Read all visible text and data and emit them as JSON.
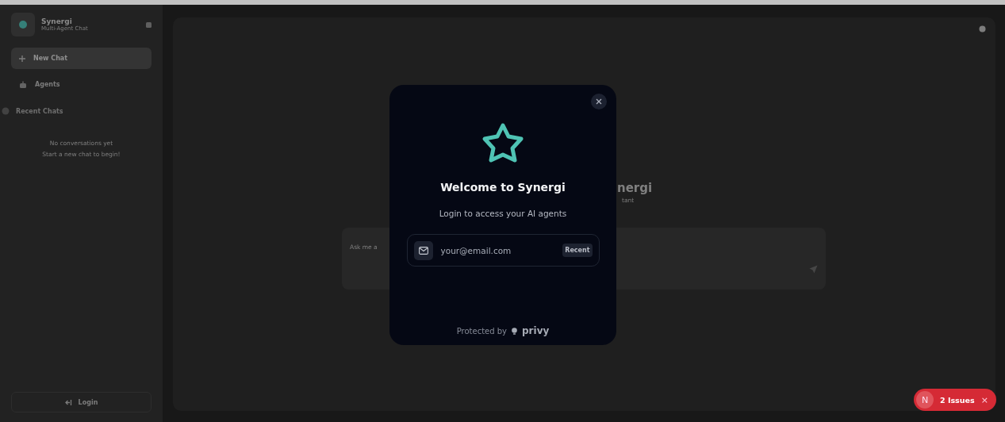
{
  "sidebar": {
    "brand": {
      "title": "Synergi",
      "subtitle": "Multi-Agent Chat"
    },
    "nav": [
      {
        "label": "New Chat",
        "kind": "new",
        "selected": true
      },
      {
        "label": "Agents",
        "kind": "agents",
        "selected": false
      }
    ],
    "recent": {
      "label": "Recent Chats",
      "empty_lines": [
        "No conversations yet",
        "Start a new chat to begin!"
      ]
    },
    "login": "Login"
  },
  "main": {
    "heading": "nergi",
    "subheading": "tant",
    "input": {
      "placeholder": "Ask me a"
    }
  },
  "modal": {
    "title": "Welcome to Synergi",
    "subtitle": "Login to access your AI agents",
    "email": {
      "placeholder": "your@email.com"
    },
    "recent_button": "Recent",
    "footer": {
      "text": "Protected by",
      "brand": "privy"
    }
  },
  "issues_badge": {
    "initial": "N",
    "label": "2 Issues",
    "close": "×"
  }
}
